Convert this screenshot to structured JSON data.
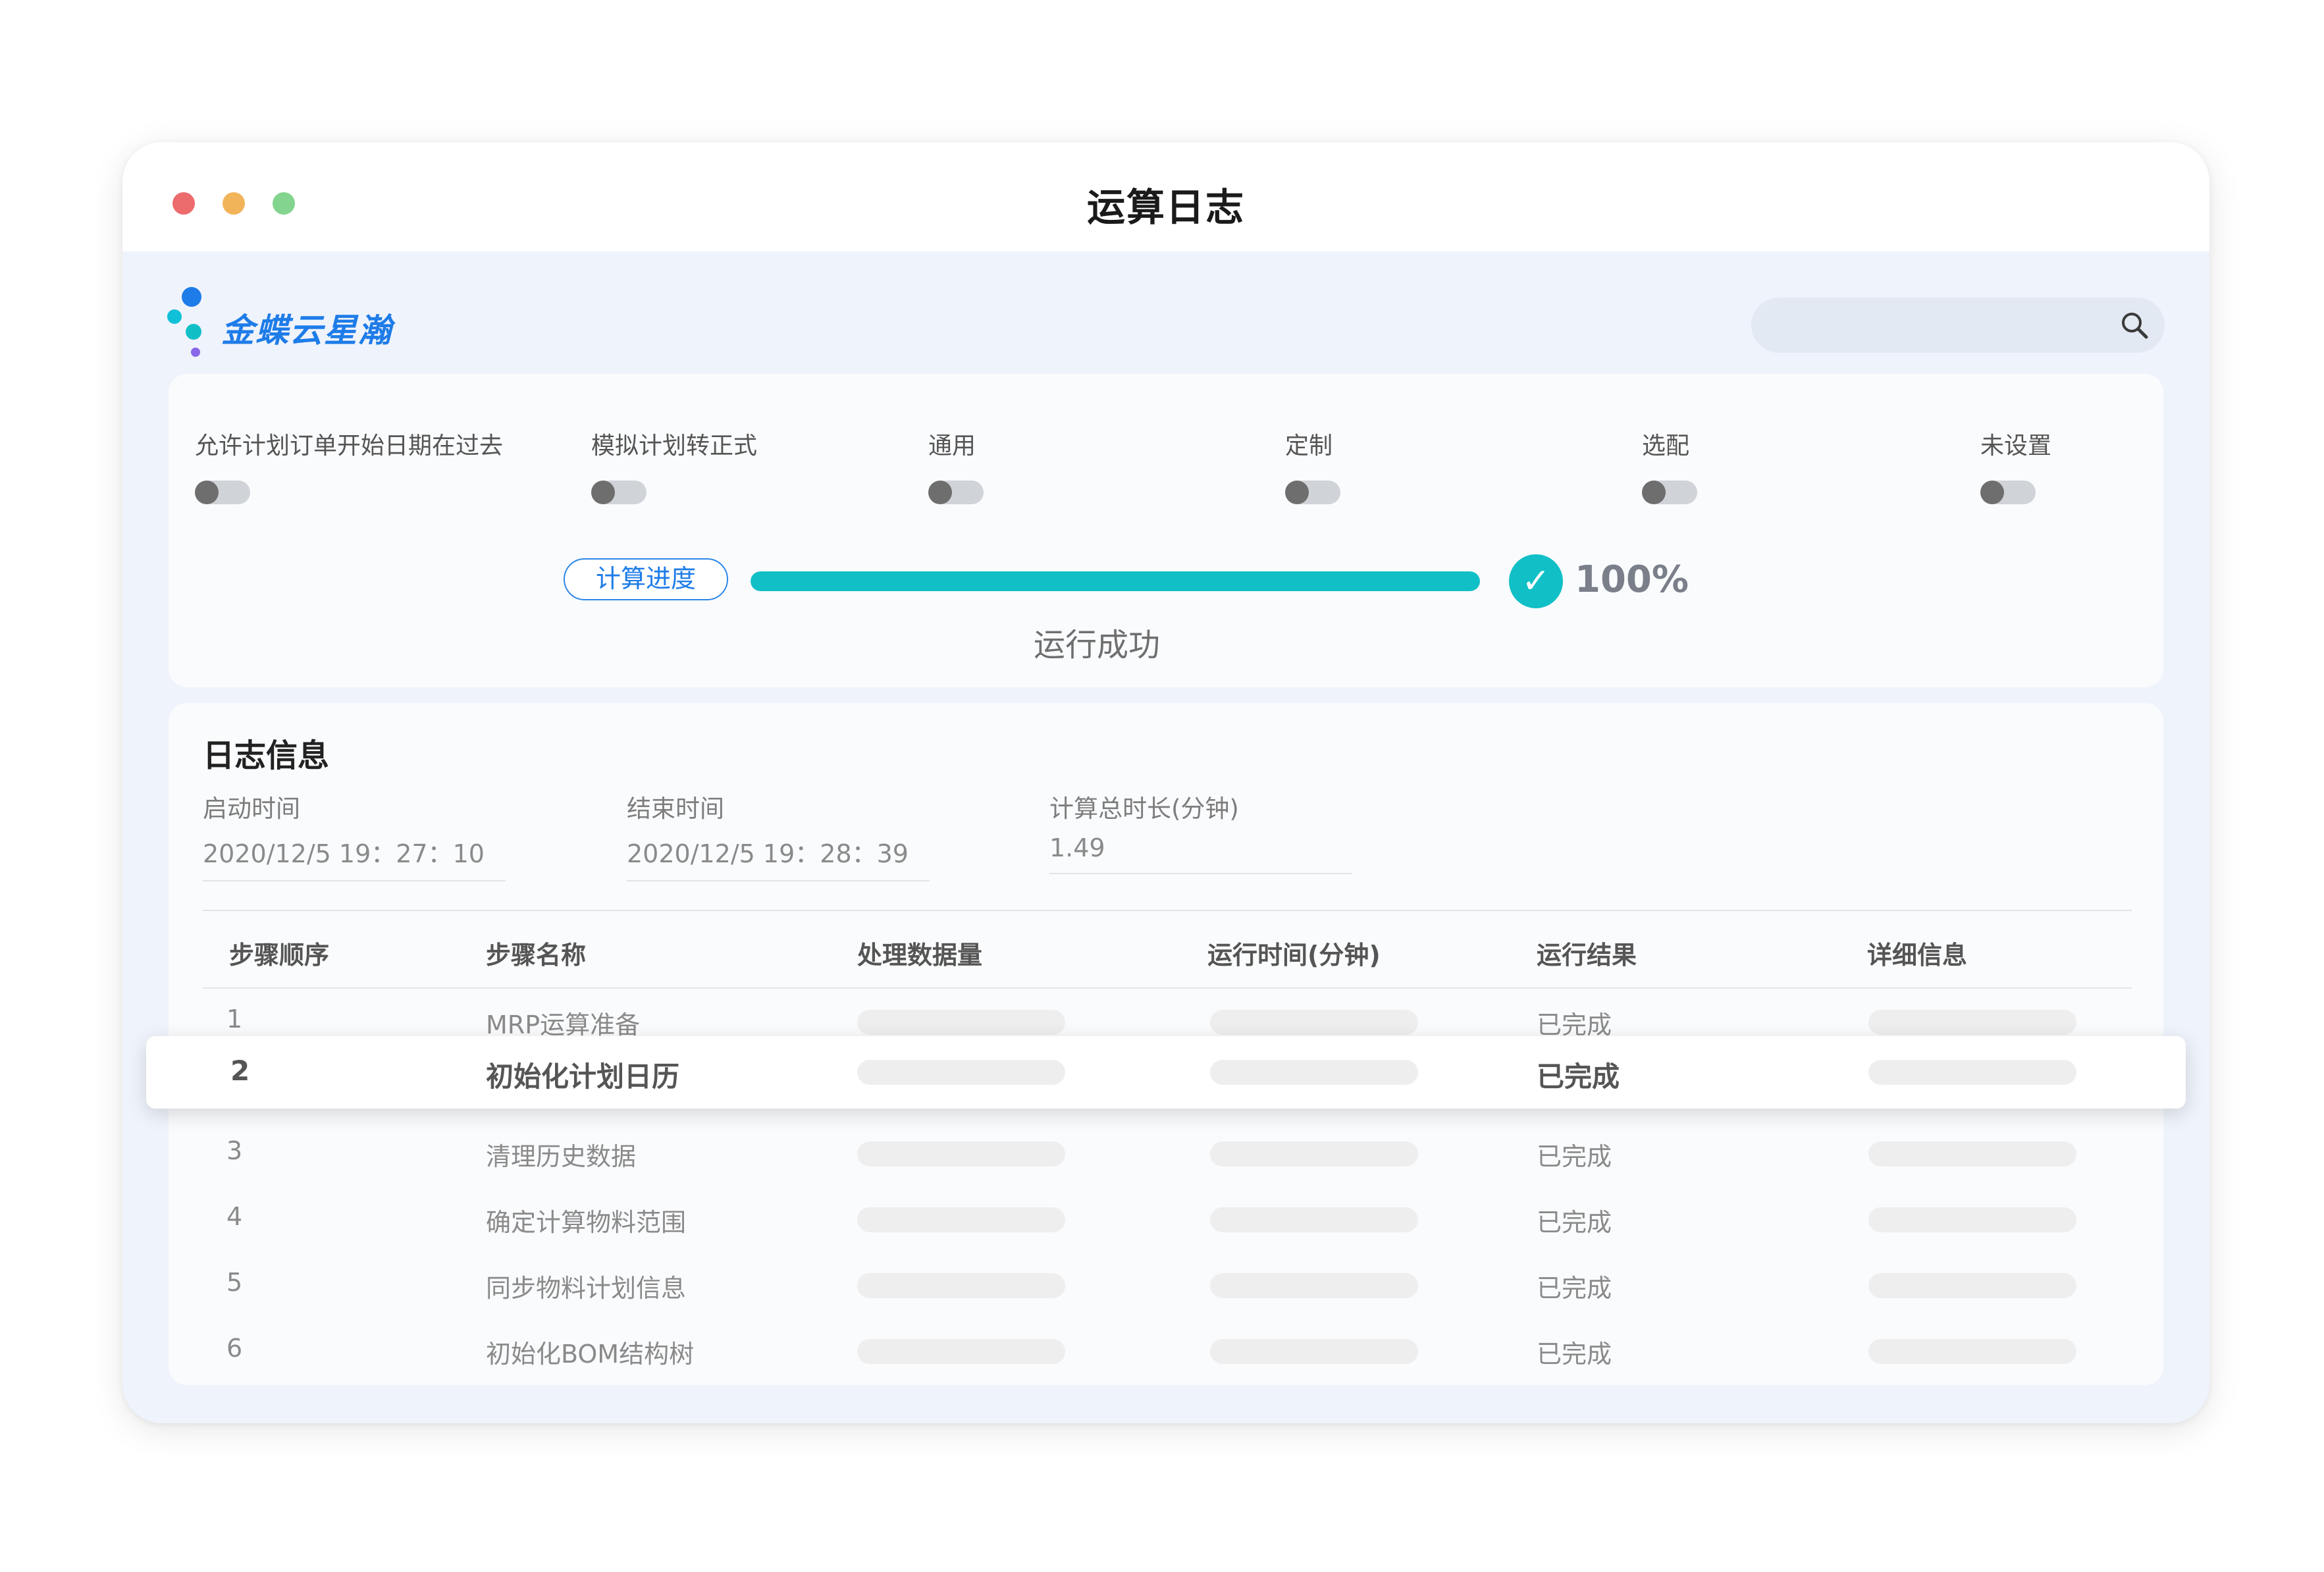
{
  "window": {
    "title": "运算日志"
  },
  "brand": {
    "name": "金蝶云星瀚"
  },
  "search": {
    "placeholder": "",
    "icon": "search-icon"
  },
  "options": [
    {
      "label": "允许计划订单开始日期在过去",
      "enabled": false
    },
    {
      "label": "模拟计划转正式",
      "enabled": false
    },
    {
      "label": "通用",
      "enabled": false
    },
    {
      "label": "定制",
      "enabled": false
    },
    {
      "label": "选配",
      "enabled": false
    },
    {
      "label": "未设置",
      "enabled": false
    }
  ],
  "progress": {
    "label": "计算进度",
    "value": 1.0,
    "percent_text": "100%",
    "status": "运行成功",
    "check_glyph": "✓"
  },
  "log": {
    "title": "日志信息",
    "start_label": "启动时间",
    "start_value": "2020/12/5 19：27：10",
    "end_label": "结束时间",
    "end_value": "2020/12/5 19：28：39",
    "duration_label": "计算总时长(分钟)",
    "duration_value": "1.49"
  },
  "table": {
    "headers": [
      "步骤顺序",
      "步骤名称",
      "处理数据量",
      "运行时间(分钟)",
      "运行结果",
      "详细信息"
    ],
    "rows": [
      {
        "order": "1",
        "name": "MRP运算准备",
        "result": "已完成"
      },
      {
        "order": "2",
        "name": "初始化计划日历",
        "result": "已完成"
      },
      {
        "order": "3",
        "name": "清理历史数据",
        "result": "已完成"
      },
      {
        "order": "4",
        "name": "确定计算物料范围",
        "result": "已完成"
      },
      {
        "order": "5",
        "name": "同步物料计划信息",
        "result": "已完成"
      },
      {
        "order": "6",
        "name": "初始化BOM结构树",
        "result": "已完成"
      }
    ],
    "highlighted_row": 1
  },
  "colors": {
    "accent": "#10c0c6",
    "brand_blue": "#1e7ce8",
    "dot_red": "#ec6b6d",
    "dot_yellow": "#f1b458",
    "dot_green": "#83d48e"
  }
}
